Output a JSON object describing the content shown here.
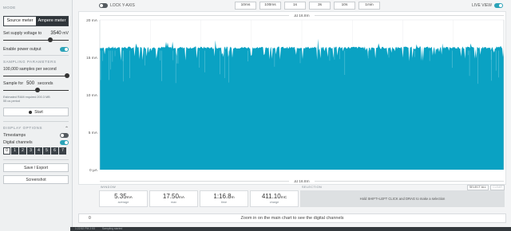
{
  "sidebar": {
    "mode_title": "MODE",
    "mode_source": "Source meter",
    "mode_ampere": "Ampere meter",
    "supply_label": "Set supply voltage to",
    "supply_value": "3540",
    "supply_unit": "mV",
    "supply_level": 0.72,
    "enable_power_label": "Enable power output",
    "enable_power_on": true,
    "sampling_title": "SAMPLING PARAMETERS",
    "samples_label": "100,000 samples per second",
    "samples_level": 0.98,
    "sample_for_label": "Sample for",
    "sample_for_value": "500",
    "sample_for_unit": "seconds",
    "sample_for_level": 0.52,
    "estimate_note": "Estimated RAM required 200.3 MB",
    "estimate_note2": "55 us period",
    "start_label": "Start",
    "display_title": "DISPLAY OPTIONS",
    "timestamps_label": "Timestamps",
    "timestamps_on": false,
    "digital_label": "Digital channels",
    "digital_on": true,
    "channels": [
      "0",
      "1",
      "2",
      "3",
      "4",
      "5",
      "6",
      "7"
    ],
    "save_label": "Save / Export",
    "screenshot_label": "Screenshot"
  },
  "topbar": {
    "lock_label": "LOCK Y-AXIS",
    "zoom_options": [
      "10ms",
      "100ms",
      "1s",
      "3s",
      "10s",
      "1min"
    ],
    "live_view_label": "LIVE VIEW"
  },
  "chart_data": {
    "type": "area",
    "ylabel_unit": "mA",
    "y_ticks": [
      "20 mA",
      "15 mA",
      "10 mA",
      "5 mA",
      "0 µA"
    ],
    "ylim": [
      0,
      20
    ],
    "baseline_level_ma": 16.3,
    "spike_min_ma": 14.5,
    "spike_max_ma": 17.5,
    "top_time_label": "Δt 16.8m",
    "bottom_time_label": "Δt 16.8m",
    "fill_color": "#0aa2c3",
    "grid": true
  },
  "stats": {
    "window_label": "WINDOW",
    "items": [
      {
        "num": "5.35",
        "unit": "mA",
        "label": "average"
      },
      {
        "num": "17.50",
        "unit": "mA",
        "label": "max"
      },
      {
        "num": "1:16.8",
        "unit": "m",
        "label": "time"
      },
      {
        "num": "411.10",
        "unit": "mC",
        "label": "charge"
      }
    ]
  },
  "selection": {
    "title": "SELECTION",
    "select_all": "SELECT ALL",
    "clear": "CLEAR",
    "hint": "Hold SHIFT+LEFT CLICK and DRAG to make a selection"
  },
  "digital": {
    "zero_label": "0",
    "message": "Zoom in on the main chart to see the digital channels"
  },
  "status": {
    "left": "1:22:52 PM 2:53",
    "right": "Sampling started"
  }
}
